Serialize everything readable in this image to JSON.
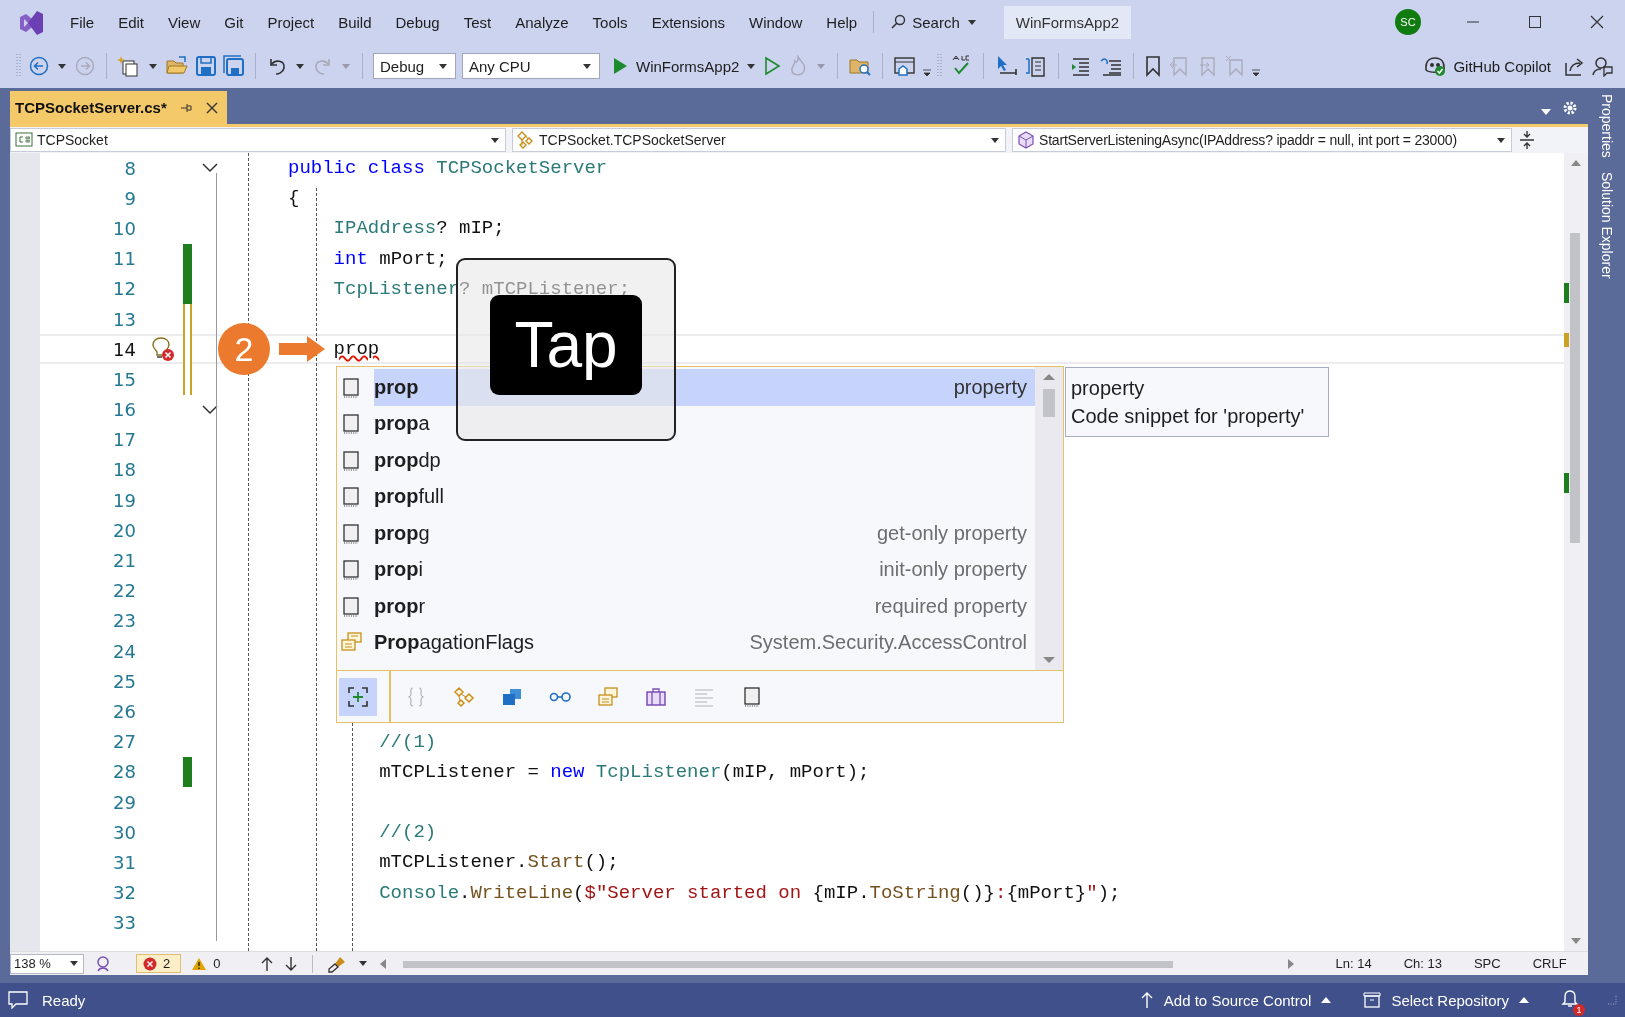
{
  "window": {
    "title": "WinFormsApp2",
    "search": "Search",
    "avatar": "SC"
  },
  "menu": [
    "File",
    "Edit",
    "View",
    "Git",
    "Project",
    "Build",
    "Debug",
    "Test",
    "Analyze",
    "Tools",
    "Extensions",
    "Window",
    "Help"
  ],
  "toolbar": {
    "configuration": "Debug",
    "platform": "Any CPU",
    "startup": "WinFormsApp2",
    "copilot": "GitHub Copilot"
  },
  "tabs": [
    {
      "label": "TCPSocketServer.cs*",
      "selected": true
    }
  ],
  "side_tabs": [
    "Properties",
    "Solution Explorer"
  ],
  "navigation": [
    "TCPSocket",
    "TCPSocket.TCPSocketServer",
    "StartServerListeningAsync(IPAddress? ipaddr = null, int port = 23000)"
  ],
  "code_lines": [
    {
      "number": "8",
      "fold": true,
      "tokens": [
        {
          "kind": "keyword",
          "text": "public class"
        },
        {
          "kind": "type",
          "text": " TCPSocketServer"
        }
      ]
    },
    {
      "number": "9",
      "tokens": [
        {
          "kind": "plain",
          "text": "{"
        }
      ]
    },
    {
      "number": "10",
      "tokens": [
        {
          "kind": "type",
          "text": "    IPAddress"
        },
        {
          "kind": "plain",
          "text": "? mIP;"
        }
      ]
    },
    {
      "number": "11",
      "changed": true,
      "saved": true,
      "tokens": [
        {
          "kind": "keyword",
          "text": "    int"
        },
        {
          "kind": "plain",
          "text": " mPort;"
        }
      ]
    },
    {
      "number": "12",
      "changed": true,
      "saved": true,
      "tokens": [
        {
          "kind": "type",
          "text": "    TcpListener"
        },
        {
          "kind": "plain",
          "text": "? mTCPListener;"
        }
      ]
    },
    {
      "number": "13",
      "changed": true,
      "saved": false
    },
    {
      "number": "14",
      "changed": true,
      "saved": false,
      "current": true,
      "bulb": true,
      "tokens": [
        {
          "kind": "error",
          "text": "    prop"
        }
      ]
    },
    {
      "number": "15",
      "changed": true,
      "saved": false
    },
    {
      "number": "16",
      "fold": true
    },
    {
      "number": "17"
    },
    {
      "number": "18"
    },
    {
      "number": "19"
    },
    {
      "number": "20"
    },
    {
      "number": "21"
    },
    {
      "number": "22"
    },
    {
      "number": "23"
    },
    {
      "number": "24"
    },
    {
      "number": "25"
    },
    {
      "number": "26"
    },
    {
      "number": "27",
      "tokens": [
        {
          "kind": "comment",
          "text": "        //(1)"
        }
      ]
    },
    {
      "number": "28",
      "changed": true,
      "saved": true,
      "tokens": [
        {
          "kind": "plain",
          "text": "        mTCPListener = "
        },
        {
          "kind": "keyword",
          "text": "new"
        },
        {
          "kind": "type",
          "text": " TcpListener"
        },
        {
          "kind": "plain",
          "text": "(mIP, mPort);"
        }
      ]
    },
    {
      "number": "29"
    },
    {
      "number": "30",
      "tokens": [
        {
          "kind": "comment",
          "text": "        //(2)"
        }
      ]
    },
    {
      "number": "31",
      "tokens": [
        {
          "kind": "plain",
          "text": "        mTCPListener."
        },
        {
          "kind": "method",
          "text": "Start"
        },
        {
          "kind": "plain",
          "text": "();"
        }
      ]
    },
    {
      "number": "32",
      "tokens": [
        {
          "kind": "type",
          "text": "        Console"
        },
        {
          "kind": "plain",
          "text": "."
        },
        {
          "kind": "method",
          "text": "WriteLine"
        },
        {
          "kind": "plain",
          "text": "("
        },
        {
          "kind": "string",
          "text": "$\"Server started on "
        },
        {
          "kind": "plain",
          "text": "{mIP."
        },
        {
          "kind": "method",
          "text": "ToString"
        },
        {
          "kind": "plain",
          "text": "()}"
        },
        {
          "kind": "string",
          "text": ":"
        },
        {
          "kind": "plain",
          "text": "{mPort}"
        },
        {
          "kind": "string",
          "text": "\""
        },
        {
          "kind": "plain",
          "text": ");"
        }
      ]
    },
    {
      "number": "33"
    }
  ],
  "completion": {
    "items": [
      {
        "kind": "snippet",
        "label": "**prop**",
        "detail": "property",
        "selected": true
      },
      {
        "kind": "snippet",
        "label": "**prop**a",
        "selected": false
      },
      {
        "kind": "snippet",
        "label": "**prop**dp",
        "selected": false
      },
      {
        "kind": "snippet",
        "label": "**prop**full",
        "selected": false
      },
      {
        "kind": "snippet",
        "label": "**prop**g",
        "detail": "get-only property",
        "selected": false
      },
      {
        "kind": "snippet",
        "label": "**prop**i",
        "detail": "init-only property",
        "selected": false
      },
      {
        "kind": "snippet",
        "label": "**prop**r",
        "detail": "required property",
        "selected": false
      },
      {
        "kind": "enum",
        "label": "**Prop**agationFlags",
        "detail": "System.Security.AccessControl",
        "selected": false
      }
    ],
    "filters": [
      {
        "kind": "expand",
        "selected": true,
        "disabled": false
      },
      {
        "kind": "braces",
        "selected": false,
        "disabled": true
      },
      {
        "kind": "diamonds",
        "selected": false,
        "disabled": false
      },
      {
        "kind": "squares",
        "selected": false,
        "disabled": false
      },
      {
        "kind": "link",
        "selected": false,
        "disabled": false
      },
      {
        "kind": "cards",
        "selected": false,
        "disabled": false
      },
      {
        "kind": "briefcase",
        "selected": false,
        "disabled": false
      },
      {
        "kind": "lines",
        "selected": false,
        "disabled": true
      },
      {
        "kind": "snippet",
        "selected": false,
        "disabled": false
      }
    ],
    "tooltip": [
      "property",
      "Code snippet for 'property'"
    ]
  },
  "overlay": {
    "step": "2",
    "gesture": "Tap"
  },
  "editor_status": {
    "zoom": "138 %",
    "errors": "2",
    "warnings": "0",
    "line": "Ln: 14",
    "column": "Ch: 13",
    "whitespace": "SPC",
    "line_endings": "CRLF"
  },
  "status_bar": {
    "message": "Ready",
    "source_control": "Add to Source Control",
    "repository": "Select Repository",
    "notifications": "1"
  }
}
